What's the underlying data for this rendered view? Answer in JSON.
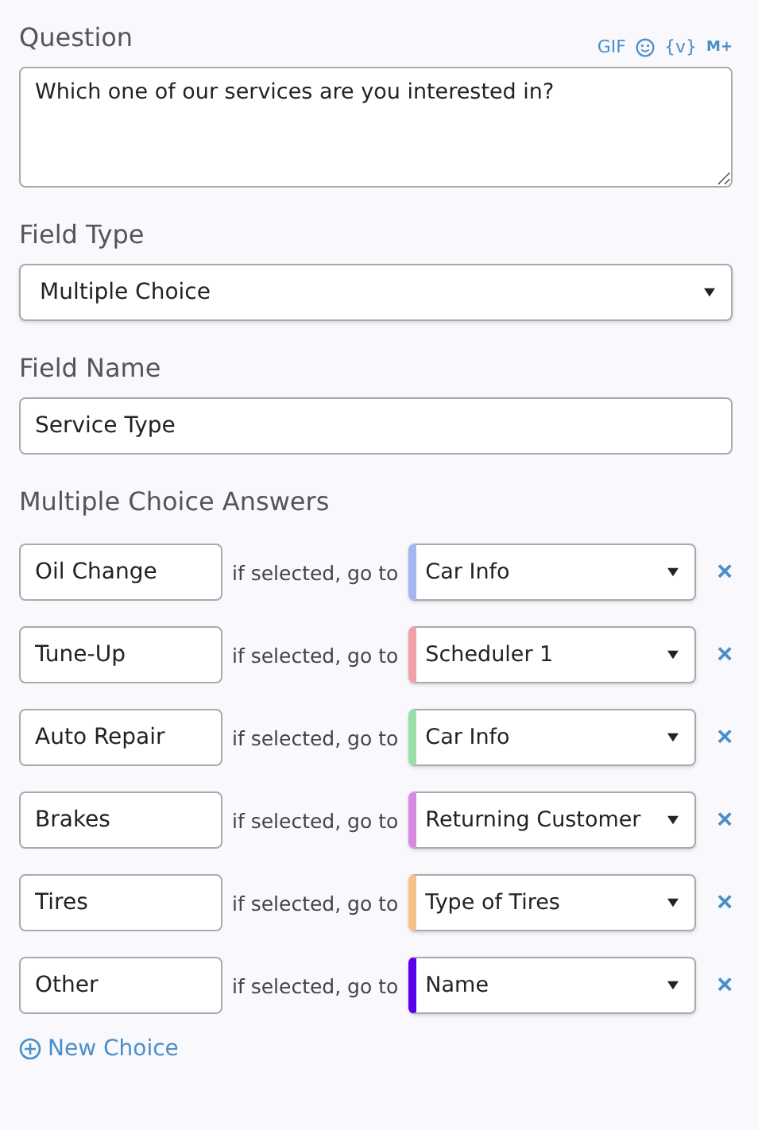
{
  "question": {
    "label": "Question",
    "tools": [
      "GIF",
      "{v}",
      "M+"
    ],
    "value": "Which one of our services are you interested in?"
  },
  "field_type": {
    "label": "Field Type",
    "value": "Multiple Choice"
  },
  "field_name": {
    "label": "Field Name",
    "value": "Service Type"
  },
  "answers_label": "Multiple Choice Answers",
  "answers": [
    {
      "answer": "Oil Change",
      "connector": "if selected, go to",
      "target": "Car Info",
      "color": "#a3b8f0",
      "remove": "×"
    },
    {
      "answer": "Tune-Up",
      "connector": "if selected, go to",
      "target": "Scheduler 1",
      "color": "#f0a0a8",
      "remove": "×"
    },
    {
      "answer": "Auto Repair",
      "connector": "if selected, go to",
      "target": "Car Info",
      "color": "#98e0a8",
      "remove": "×"
    },
    {
      "answer": "Brakes",
      "connector": "if selected, go to",
      "target": "Returning Customer",
      "color": "#d88ae0",
      "remove": "×"
    },
    {
      "answer": "Tires",
      "connector": "if selected, go to",
      "target": "Type of Tires",
      "color": "#f5c08a",
      "remove": "×"
    },
    {
      "answer": "Other",
      "connector": "if selected, go to",
      "target": "Name",
      "color": "#5a00f0",
      "remove": "×"
    }
  ],
  "new_choice": "New Choice"
}
